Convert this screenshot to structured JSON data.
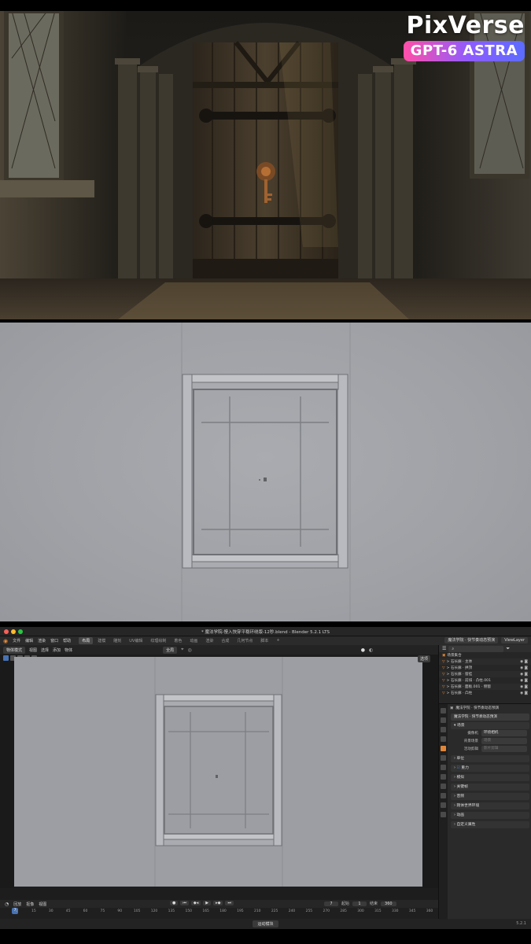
{
  "render": {
    "brand_name": "PixVerse",
    "brand_badge": "GPT-6 ASTRA"
  },
  "blender": {
    "window_title": "* 魔法学院-慢入快穿平稳环绕版-12秒.blend - Blender 5.2.1 LTS",
    "menus": [
      "文件",
      "编辑",
      "渲染",
      "窗口",
      "帮助"
    ],
    "workspace_tabs": [
      {
        "label": "布局",
        "active": true
      },
      {
        "label": "建模",
        "active": false
      },
      {
        "label": "雕刻",
        "active": false
      },
      {
        "label": "UV编辑",
        "active": false
      },
      {
        "label": "纹理绘制",
        "active": false
      },
      {
        "label": "着色",
        "active": false
      },
      {
        "label": "动画",
        "active": false
      },
      {
        "label": "渲染",
        "active": false
      },
      {
        "label": "合成",
        "active": false
      },
      {
        "label": "几何节点",
        "active": false
      },
      {
        "label": "脚本",
        "active": false
      }
    ],
    "scene_field": "魔法学院 · 快节奏动态预演",
    "view_layer": "ViewLayer",
    "viewport_header": {
      "mode": "物体模式",
      "menus": [
        "视图",
        "选择",
        "添加",
        "物体"
      ],
      "transform": "全局",
      "options": "选项"
    },
    "outliner": {
      "search_placeholder": "",
      "rows": [
        {
          "label": "场景集合",
          "alt": false,
          "vis": ""
        },
        {
          "label": "> 石长廊 · 主体",
          "alt": true,
          "vis": "◉ ◙"
        },
        {
          "label": "> 石长廊 · 拱顶",
          "alt": false,
          "vis": "◉ ◙"
        },
        {
          "label": "> 石长廊 · 窗挂",
          "alt": true,
          "vis": "◉ ◙"
        },
        {
          "label": "> 石长廊 · 前排 · 凸柱.001",
          "alt": false,
          "vis": "◉ ◙"
        },
        {
          "label": "> 石长廊 · 面板.001 · 侧窗",
          "alt": true,
          "vis": "◉ ◙"
        },
        {
          "label": "> 石长廊 · 凸柱",
          "alt": false,
          "vis": "◉ ◙"
        }
      ]
    },
    "properties": {
      "path": "魔法学院 · 快节奏动态预演",
      "name": "魔法学院 · 快节奏动态预演",
      "section_scene": "场景",
      "camera_label": "摄像机",
      "camera_value": "环绕相机",
      "background_label": "背景场景",
      "background_value": "场景",
      "active_clip_label": "活动剪辑",
      "active_clip_value": "影片剪辑",
      "sections": [
        "单位",
        "重力",
        "模拟",
        "关键帧",
        "音频",
        "刚体世界环境",
        "动画",
        "自定义属性"
      ],
      "gravity_checked": true
    },
    "timeline": {
      "menus": [
        "回放",
        "抠像",
        "视图"
      ],
      "current_frame": "7",
      "start_label": "起始",
      "start_value": "1",
      "end_label": "结束",
      "end_value": "360",
      "ticks": [
        "1",
        "15",
        "30",
        "45",
        "60",
        "75",
        "90",
        "105",
        "120",
        "135",
        "150",
        "165",
        "180",
        "195",
        "210",
        "225",
        "240",
        "255",
        "270",
        "285",
        "300",
        "315",
        "330",
        "345",
        "360"
      ],
      "playhead": "7"
    },
    "status_chip": "运动模块",
    "version": "5.2.1"
  }
}
